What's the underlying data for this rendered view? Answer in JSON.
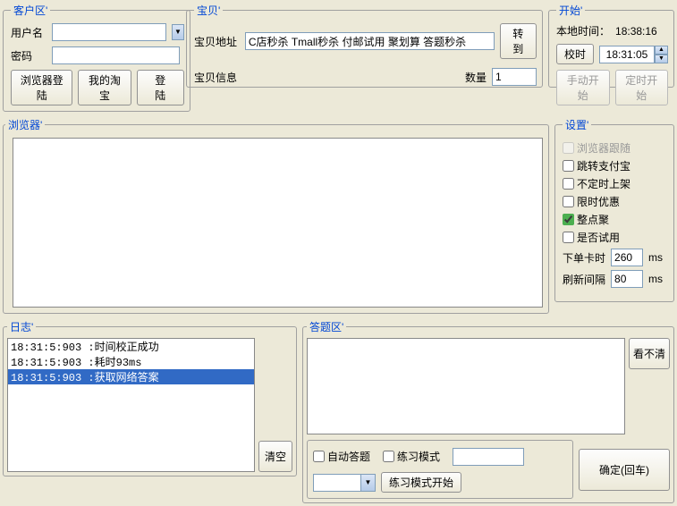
{
  "account": {
    "legend": "客户区'",
    "user_label": "用户名",
    "pass_label": "密码",
    "browser_login": "浏览器登陆",
    "my_taobao": "我的淘宝",
    "login": "登  陆"
  },
  "item": {
    "legend": "宝贝'",
    "addr_label": "宝贝地址",
    "addr_value": "C店秒杀 Tmall秒杀 付邮试用 聚划算 答题秒杀",
    "goto": "转到",
    "info_label": "宝贝信息",
    "qty_label": "数量",
    "qty_value": "1"
  },
  "start": {
    "legend": "开始'",
    "local_time_label": "本地时间：",
    "local_time_value": "18:38:16",
    "calib": "校时",
    "time_value": "18:31:05",
    "manual": "手动开始",
    "timed": "定时开始"
  },
  "browser": {
    "legend": "浏览器'"
  },
  "settings": {
    "legend": "设置'",
    "follow": "浏览器跟随",
    "alipay": "跳转支付宝",
    "unshelf": "不定时上架",
    "discount": "限时优惠",
    "zhengdian": "整点聚",
    "trial": "是否试用",
    "order_delay_label": "下单卡时",
    "order_delay_value": "260",
    "refresh_label": "刷新间隔",
    "refresh_value": "80",
    "ms": "ms"
  },
  "log": {
    "legend": "日志'",
    "lines": [
      "18:31:5:903 :时间校正成功",
      "18:31:5:903 :耗时93ms",
      "18:31:5:903 :获取网络答案"
    ],
    "clear": "清空"
  },
  "answer": {
    "legend": "答题区'",
    "cant_see": "看不清",
    "auto": "自动答题",
    "practice": "练习模式",
    "practice_start": "练习模式开始",
    "confirm": "确定(回车)"
  }
}
